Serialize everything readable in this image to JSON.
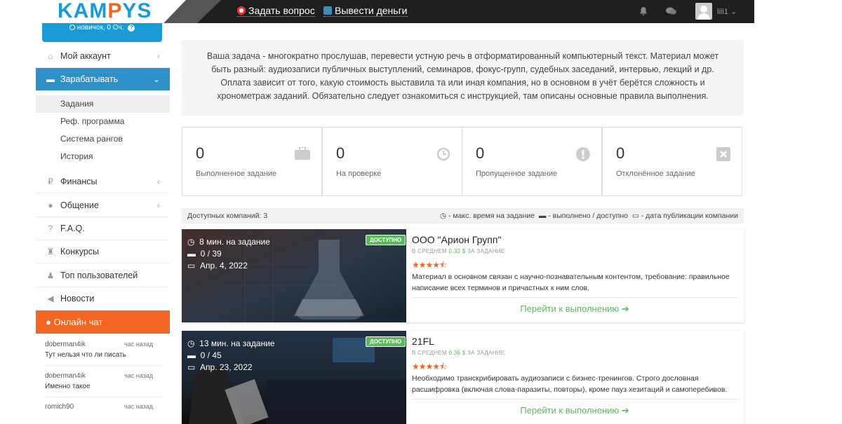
{
  "header": {
    "logo_part1": "KAM",
    "logo_o": "P",
    "logo_part2": "YS",
    "ask_question": "Задать вопрос",
    "withdraw": "Вывести деньги",
    "username": "lili1"
  },
  "rank": "новичок, 0 Оч.",
  "sidebar": {
    "items": [
      {
        "label": "Мой аккаунт",
        "icon": "dashboard-icon"
      },
      {
        "label": "Зарабатывать",
        "icon": "briefcase-icon"
      },
      {
        "label": "Финансы",
        "icon": "ruble-icon"
      },
      {
        "label": "Общение",
        "icon": "comments-icon"
      },
      {
        "label": "F.A.Q.",
        "icon": "question-icon"
      },
      {
        "label": "Конкурсы",
        "icon": "trophy-icon"
      },
      {
        "label": "Топ пользователей",
        "icon": "users-icon"
      },
      {
        "label": "Новости",
        "icon": "bullhorn-icon"
      }
    ],
    "sub_items": [
      "Задания",
      "Реф. программа",
      "Система рангов",
      "История"
    ]
  },
  "chat": {
    "title": "Онлайн чат",
    "messages": [
      {
        "name": "doberman4ik",
        "time": "час назад",
        "text": "Тут нельзя что ли писать"
      },
      {
        "name": "doberman4ik",
        "time": "час назад",
        "text": "Именно такое"
      },
      {
        "name": "romich90",
        "time": "час назад",
        "text": ""
      }
    ]
  },
  "intro_text": "Ваша задача - многократно прослушав, перевести устную речь в отформатированный компьютерный текст. Материал может быть разный: аудиозаписи публичных выступлений, семинаров, фокус-групп, судебных заседаний, интервью, лекций и др. Оплата зависит от того, какую стоимость выставила та или иная компания, но в основном в учёт берётся сложность и хронометраж заданий. Обязательно следует ознакомиться с инструкцией, там описаны основные правила выполнения.",
  "stats": [
    {
      "value": "0",
      "label": "Выполненное задание",
      "icon": "briefcase-icon"
    },
    {
      "value": "0",
      "label": "На проверке",
      "icon": "clock-icon"
    },
    {
      "value": "0",
      "label": "Пропущенное задание",
      "icon": "exclamation-icon"
    },
    {
      "value": "0",
      "label": "Отклонённое задание",
      "icon": "close-icon"
    }
  ],
  "filter": {
    "available": "Доступных компаний: 3",
    "legend_time": "- макс. время на задание",
    "legend_done": "- выполнено / доступно",
    "legend_date": "- дата публикации компании"
  },
  "cards": [
    {
      "time": "8 мин. на задание",
      "progress": "0 / 39",
      "date": "Апр. 4, 2022",
      "badge": "ДОСТУПНО",
      "title": "ООО \"Арион Групп\"",
      "avg_prefix": "В СРЕДНЕМ",
      "avg_value": "0.32 $",
      "avg_suffix": "ЗА ЗАДАНИЕ",
      "stars": "★★★★⯪",
      "rating": 4.5,
      "description": "Материал в основном связан с научно-познавательным контентом, требование: правильное написание всех терминов и причастных к ним слов.",
      "action": "Перейти к выполнению ➔"
    },
    {
      "time": "13 мин. на задание",
      "progress": "0 / 45",
      "date": "Апр. 23, 2022",
      "badge": "ДОСТУПНО",
      "title": "21FL",
      "avg_prefix": "В СРЕДНЕМ",
      "avg_value": "0.36 $",
      "avg_suffix": "ЗА ЗАДАНИЕ",
      "stars": "★★★★⯪",
      "rating": 4.5,
      "description": "Необходимо транскрибировать аудиозаписи с бизнес-тренингов. Строго дословная расшифровка (включая слова-паразиты, повторы), кроме пауз хезитаций и самоперебивов.",
      "action": "Перейти к выполнению ➔"
    }
  ],
  "colors": {
    "accent": "#1a9bd7",
    "orange": "#f26522",
    "green": "#5cb85c",
    "active": "#2e8fc9"
  }
}
